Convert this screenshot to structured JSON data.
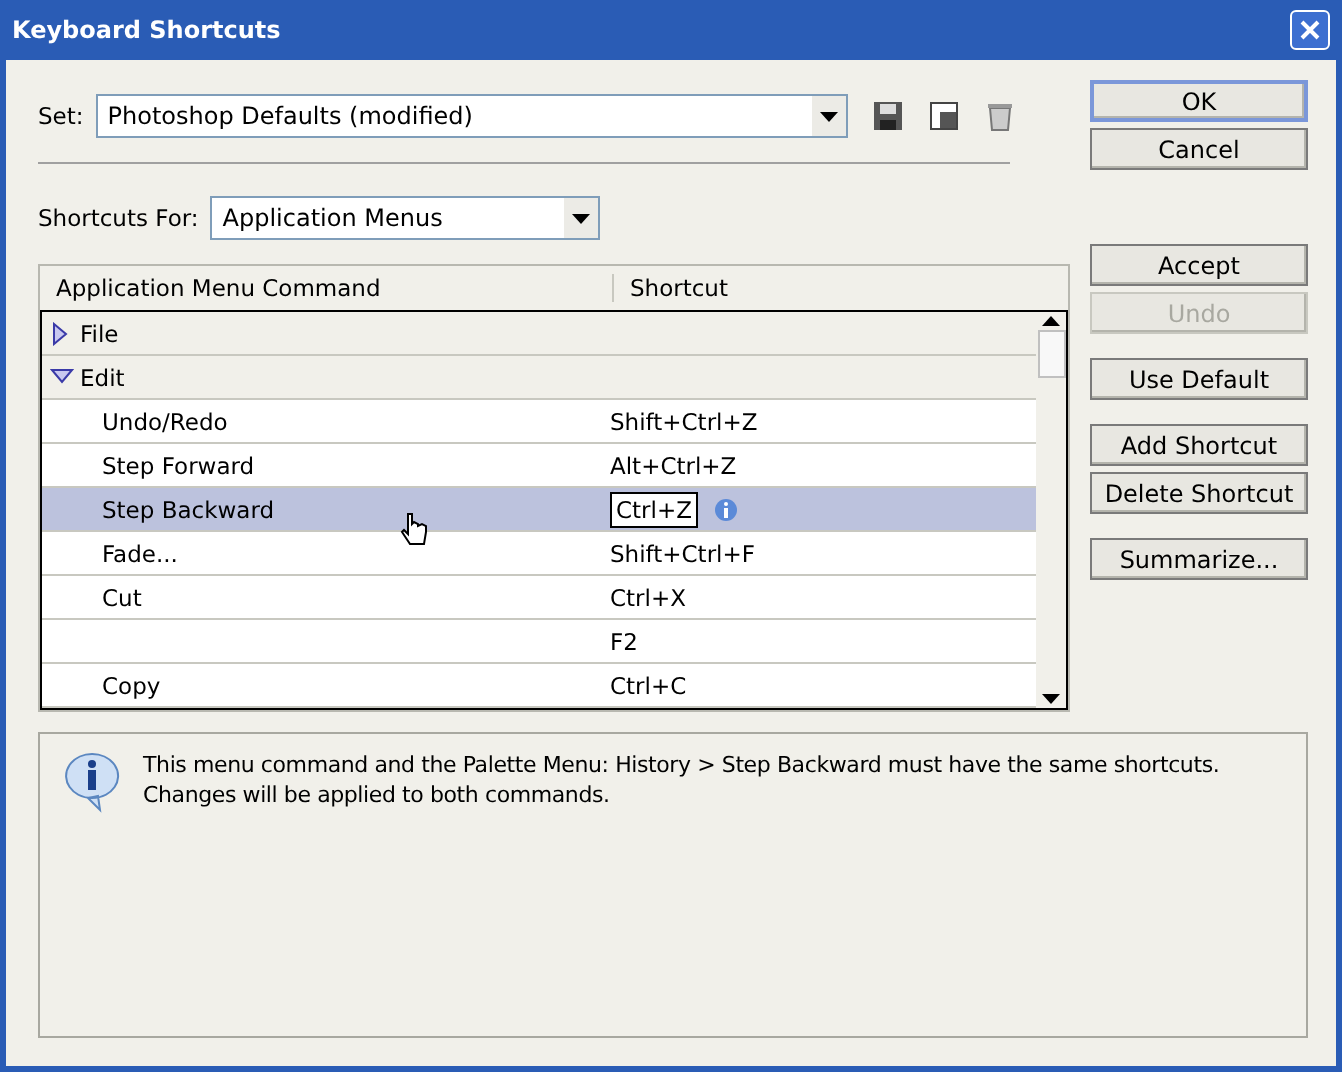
{
  "window": {
    "title": "Keyboard Shortcuts"
  },
  "set": {
    "label": "Set:",
    "value": "Photoshop Defaults (modified)"
  },
  "shortcuts_for": {
    "label": "Shortcuts For:",
    "value": "Application Menus"
  },
  "table": {
    "columns": [
      "Application Menu Command",
      "Shortcut"
    ],
    "rows": [
      {
        "kind": "group",
        "command": "File",
        "expanded": false,
        "selected": false
      },
      {
        "kind": "group",
        "command": "Edit",
        "expanded": true,
        "selected": false
      },
      {
        "kind": "item",
        "command": "Undo/Redo",
        "shortcut": "Shift+Ctrl+Z",
        "selected": false
      },
      {
        "kind": "item",
        "command": "Step Forward",
        "shortcut": "Alt+Ctrl+Z",
        "selected": false
      },
      {
        "kind": "item",
        "command": "Step Backward",
        "shortcut": "Ctrl+Z",
        "selected": true
      },
      {
        "kind": "item",
        "command": "Fade...",
        "shortcut": "Shift+Ctrl+F",
        "selected": false
      },
      {
        "kind": "item",
        "command": "Cut",
        "shortcut": "Ctrl+X",
        "selected": false
      },
      {
        "kind": "item",
        "shortcut": "F2",
        "selected": false
      },
      {
        "kind": "item",
        "command": "Copy",
        "shortcut": "Ctrl+C",
        "selected": false
      }
    ]
  },
  "top_buttons": [
    {
      "label": "OK",
      "default": true,
      "disabled": false
    },
    {
      "label": "Cancel",
      "default": false,
      "disabled": false
    }
  ],
  "side_buttons": [
    {
      "label": "Accept",
      "disabled": false
    },
    {
      "label": "Undo",
      "disabled": true
    },
    {
      "label": "Use Default",
      "disabled": false
    },
    {
      "label": "Add Shortcut",
      "disabled": false
    },
    {
      "label": "Delete Shortcut",
      "disabled": false
    },
    {
      "label": "Summarize...",
      "disabled": false
    }
  ],
  "message": "This menu command and the Palette Menu: History > Step Backward must have the same shortcuts. Changes will be applied to both commands."
}
